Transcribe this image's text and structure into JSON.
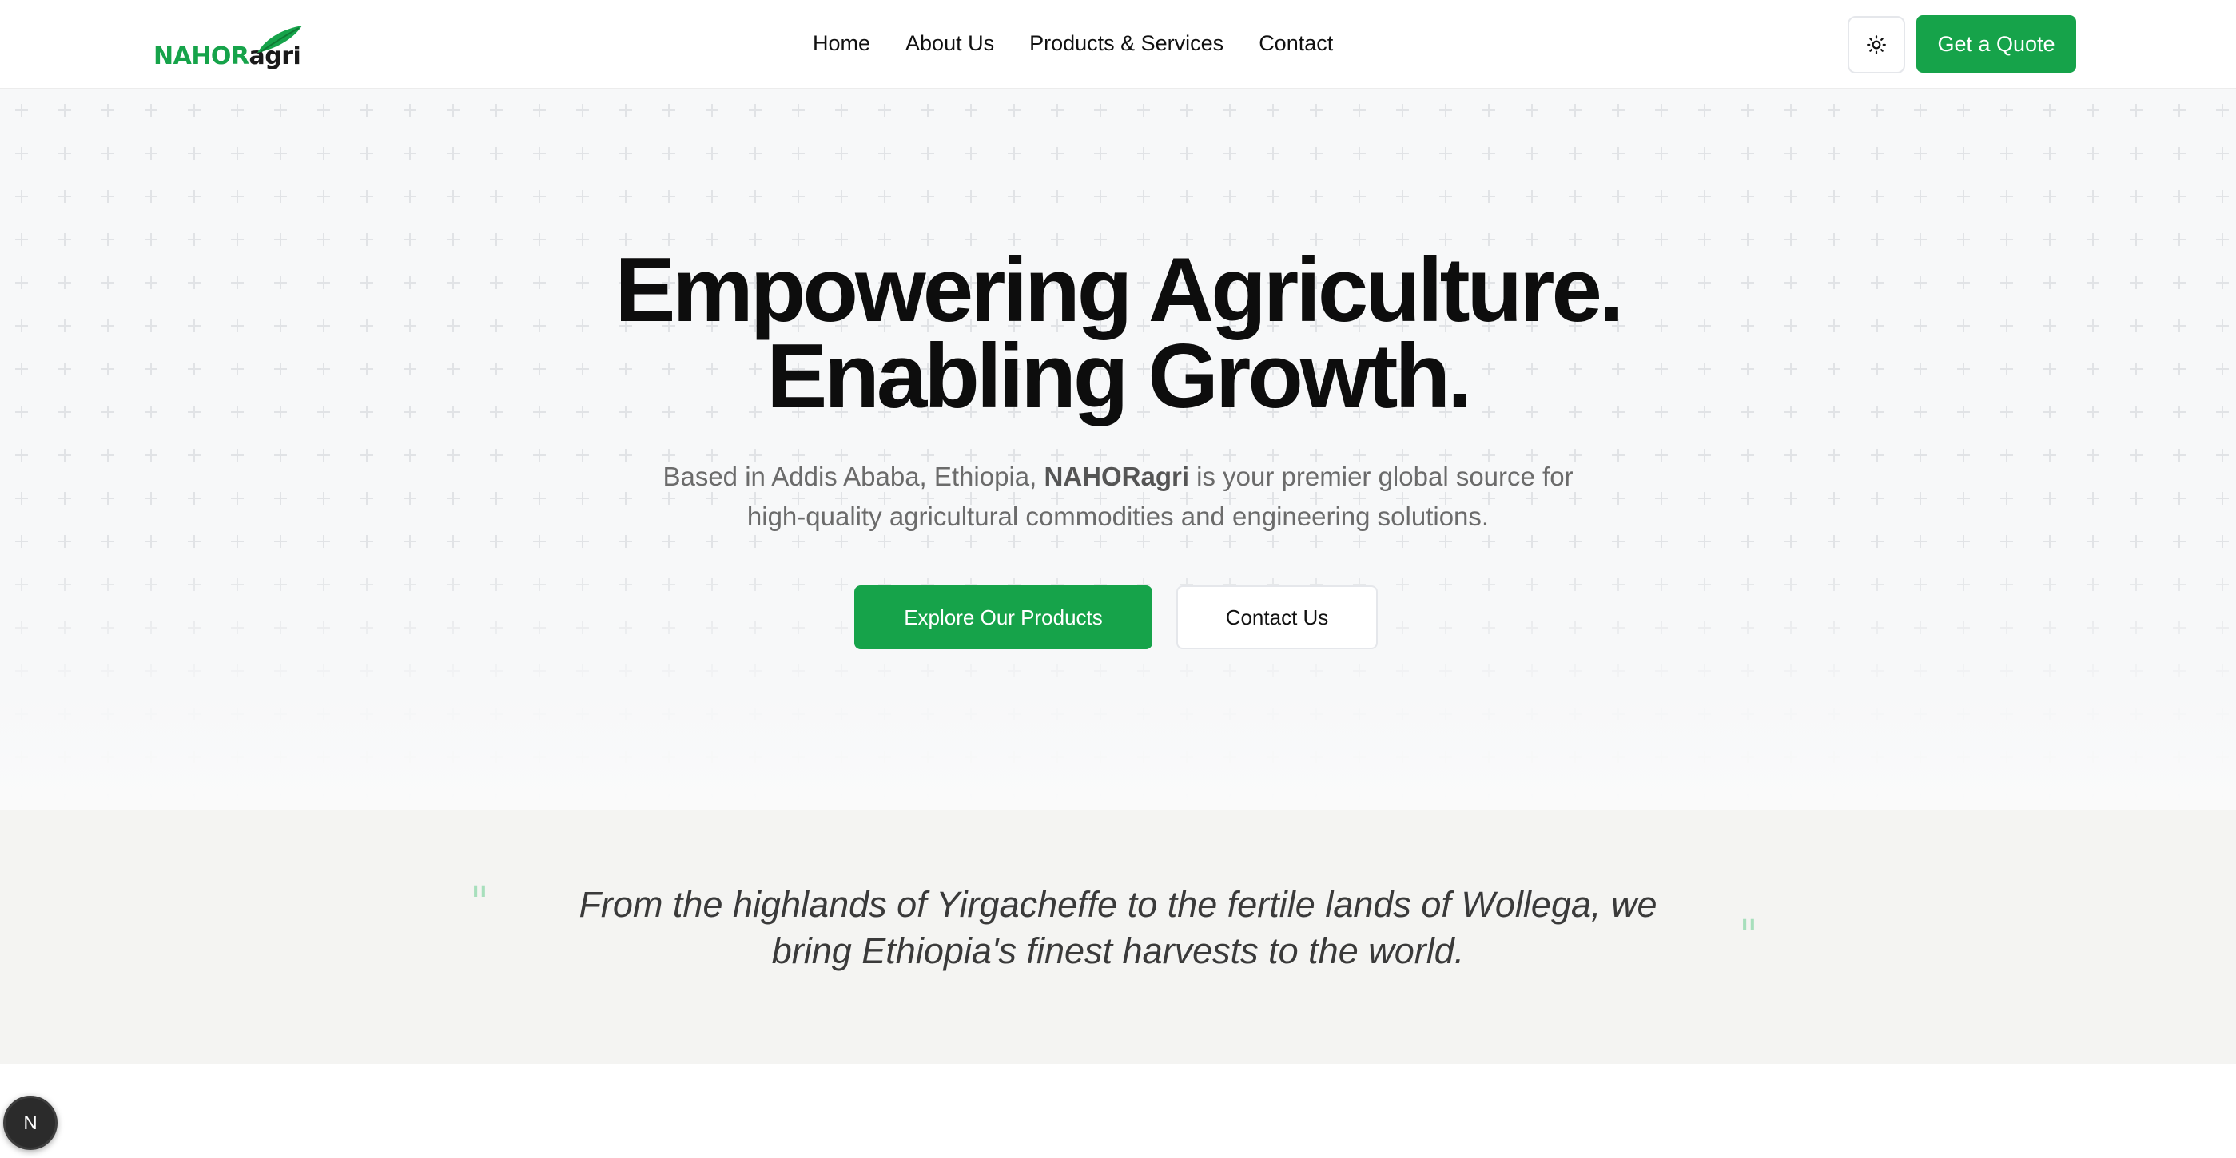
{
  "header": {
    "logo": {
      "part_green": "NAHOR",
      "part_dark": "agri",
      "icon": "leaf-icon"
    },
    "nav": [
      {
        "label": "Home"
      },
      {
        "label": "About Us"
      },
      {
        "label": "Products & Services"
      },
      {
        "label": "Contact"
      }
    ],
    "theme_toggle_icon": "sun-icon",
    "cta_label": "Get a Quote"
  },
  "hero": {
    "title_line1": "Empowering Agriculture.",
    "title_line2": "Enabling Growth.",
    "subtitle_prefix": "Based in Addis Ababa, Ethiopia, ",
    "subtitle_brand": "NAHORagri",
    "subtitle_suffix": " is your premier global source for",
    "subtitle_line2": "high-quality agricultural commodities and engineering solutions.",
    "primary_button": "Explore Our Products",
    "secondary_button": "Contact Us"
  },
  "quote": {
    "open_mark": "\"",
    "close_mark": "\"",
    "line1": "From the highlands of Yirgacheffe to the fertile lands of Wollega, we",
    "line2": "bring Ethiopia's finest harvests to the world."
  },
  "dev_badge": {
    "letter": "N"
  },
  "colors": {
    "brand_green": "#16a34a",
    "quote_mark": "#a7dfbc",
    "hero_bg": "#f7f8f9",
    "quote_bg": "#f4f4f2"
  }
}
